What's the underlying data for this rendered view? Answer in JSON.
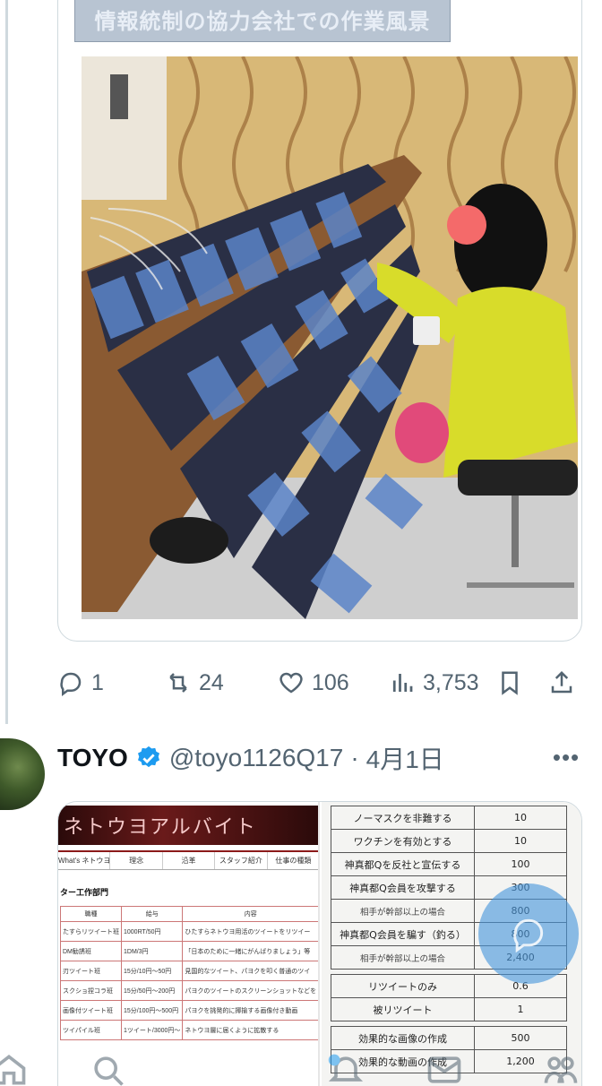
{
  "tweet1": {
    "image_caption": "情報統制の協力会社での作業風景",
    "stats": {
      "replies": "1",
      "retweets": "24",
      "likes": "106",
      "views": "3,753"
    }
  },
  "tweet2": {
    "display_name": "TOYO",
    "handle": "@toyo1126Q17",
    "separator": "·",
    "date": "4月1日",
    "more": "•••",
    "left_doc": {
      "banner": "ネトウヨアルバイト",
      "nav": [
        "What's ネトウヨバイト",
        "理念",
        "沿革",
        "スタッフ紹介",
        "仕事の種類"
      ],
      "section": "ター工作部門",
      "headers": [
        "職種",
        "給与",
        "内容"
      ],
      "rows": [
        [
          "たすらリツイート班",
          "1000RT/50円",
          "ひたすらネトウヨ用活のツイートをリツイー"
        ],
        [
          "DM勧誘班",
          "1DM/3円",
          "「日本のために一緒にがんばりましょう」等"
        ],
        [
          "刃ツイート班",
          "15分/10円〜50円",
          "見国的なツイート、パヨクを叩く普通のツイ"
        ],
        [
          "スクショ捏コラ班",
          "15分/50円〜200円",
          "パヨクのツイートのスクリーンショットなどを"
        ],
        [
          "画像付ツイート班",
          "15分/100円〜500円",
          "パヨクを挑発的に揶揄する画像付き動画"
        ],
        [
          "ツイパイル班",
          "1ツイート/3000円〜",
          "ネトウヨ層に届くように拡散する"
        ]
      ]
    },
    "right_doc": {
      "rows": [
        {
          "label": "ノーマスクを非難する",
          "value": "10"
        },
        {
          "label": "ワクチンを有効とする",
          "value": "10"
        },
        {
          "label": "神真都Qを反社と宣伝する",
          "value": "100"
        },
        {
          "label": "神真都Q会員を攻撃する",
          "value": "300"
        },
        {
          "label": "相手が幹部以上の場合",
          "value": "800",
          "sub": true
        },
        {
          "label": "神真都Q会員を騙す（釣る）",
          "value": "800"
        },
        {
          "label": "相手が幹部以上の場合",
          "value": "2,400",
          "sub": true
        },
        {
          "gap": true
        },
        {
          "label": "リツイートのみ",
          "value": "0.6"
        },
        {
          "label": "被リツイート",
          "value": "1"
        },
        {
          "gap": true
        },
        {
          "label": "効果的な画像の作成",
          "value": "500"
        },
        {
          "label": "効果的な動画の作成",
          "value": "1,200"
        }
      ]
    }
  },
  "colors": {
    "accent_blue": "#1d9bf0",
    "muted_text": "#536471",
    "border": "#cfd9de"
  }
}
